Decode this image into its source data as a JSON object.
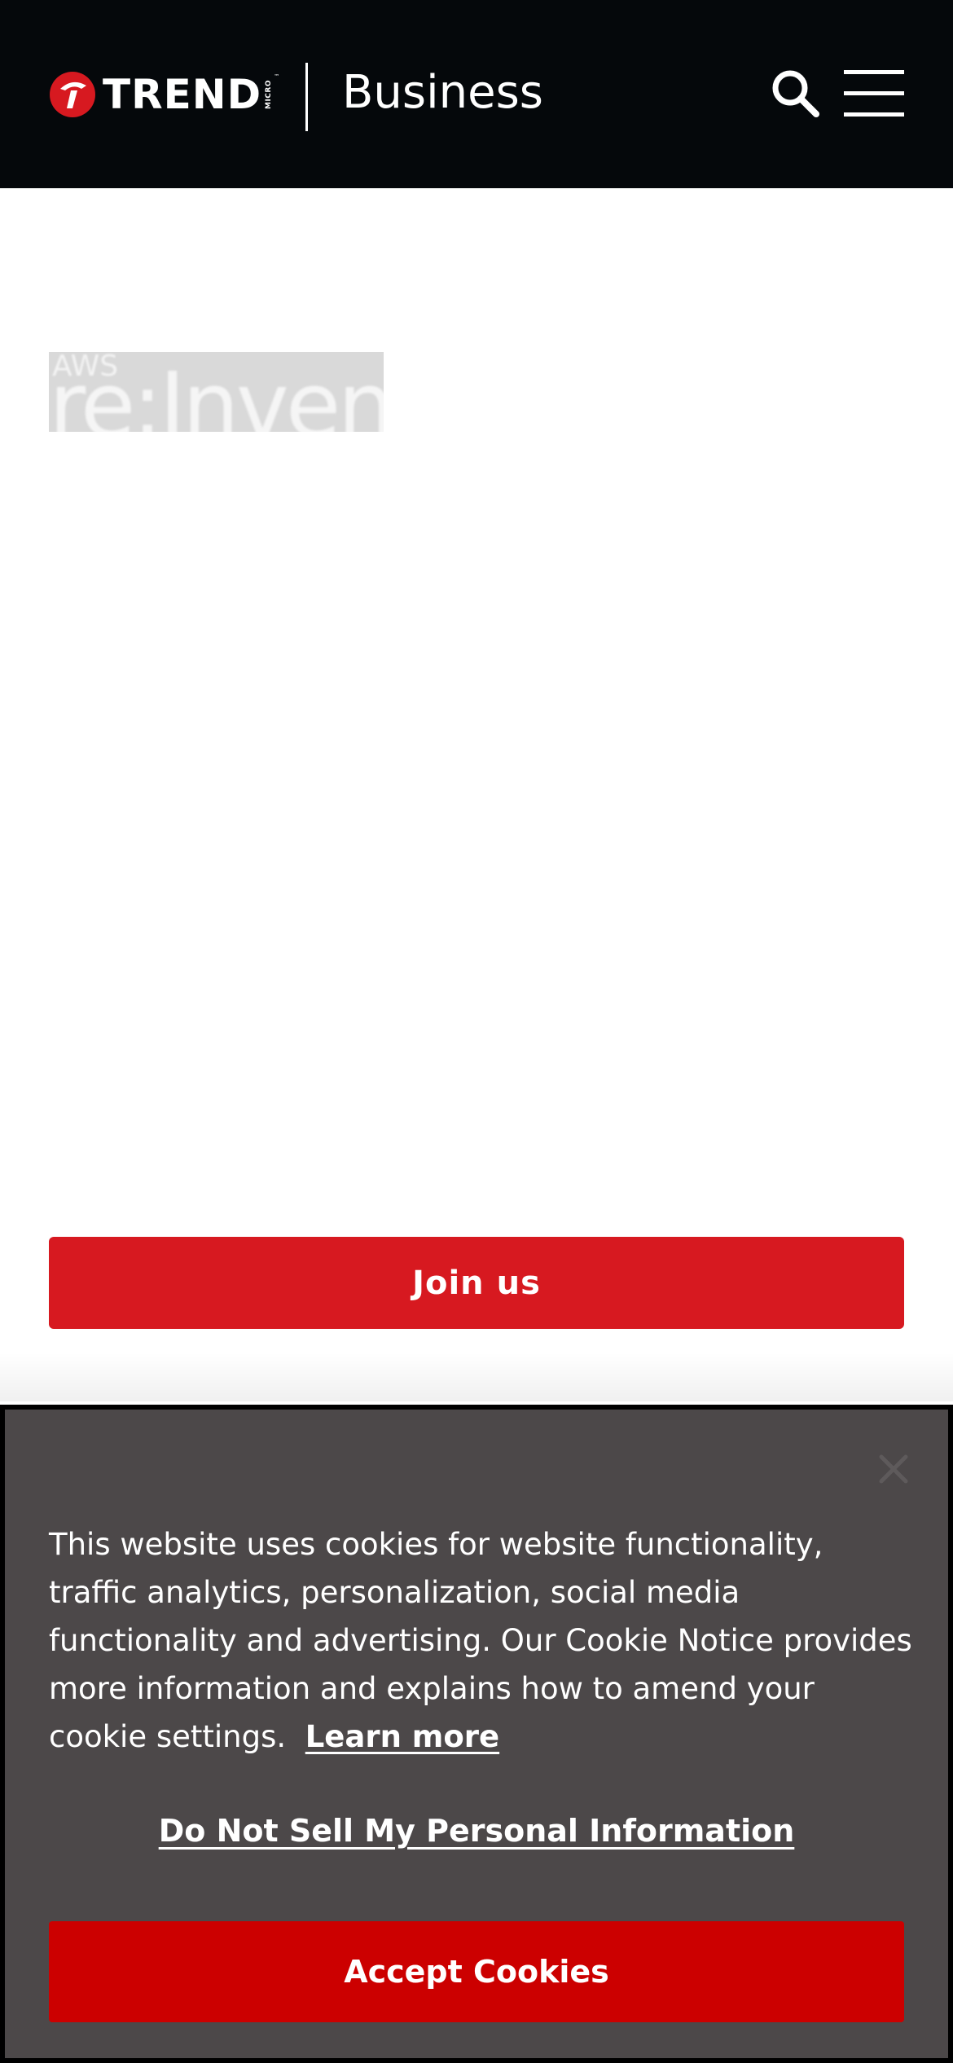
{
  "header": {
    "logo_wordmark": "TREND",
    "logo_micro": "MICRO",
    "logo_tm": "™",
    "title": "Business",
    "search_icon": "search-icon",
    "menu_icon": "hamburger-menu-icon"
  },
  "event": {
    "logo_prefix": "AWS",
    "logo_name": "re:Invent"
  },
  "main": {
    "join_label": "Join us"
  },
  "cookie_banner": {
    "message": "This website uses cookies for website functionality, traffic analytics, personalization, social media functionality and advertising. Our Cookie Notice provides more information and explains how to amend your cookie settings.",
    "learn_more_label": "Learn more",
    "do_not_sell_label": "Do Not Sell My Personal Information",
    "accept_label": "Accept Cookies",
    "close_icon": "close-icon"
  },
  "colors": {
    "header_bg": "#05080b",
    "brand_red": "#d71920",
    "accept_red": "#cc0000",
    "banner_bg": "#4c4849"
  }
}
